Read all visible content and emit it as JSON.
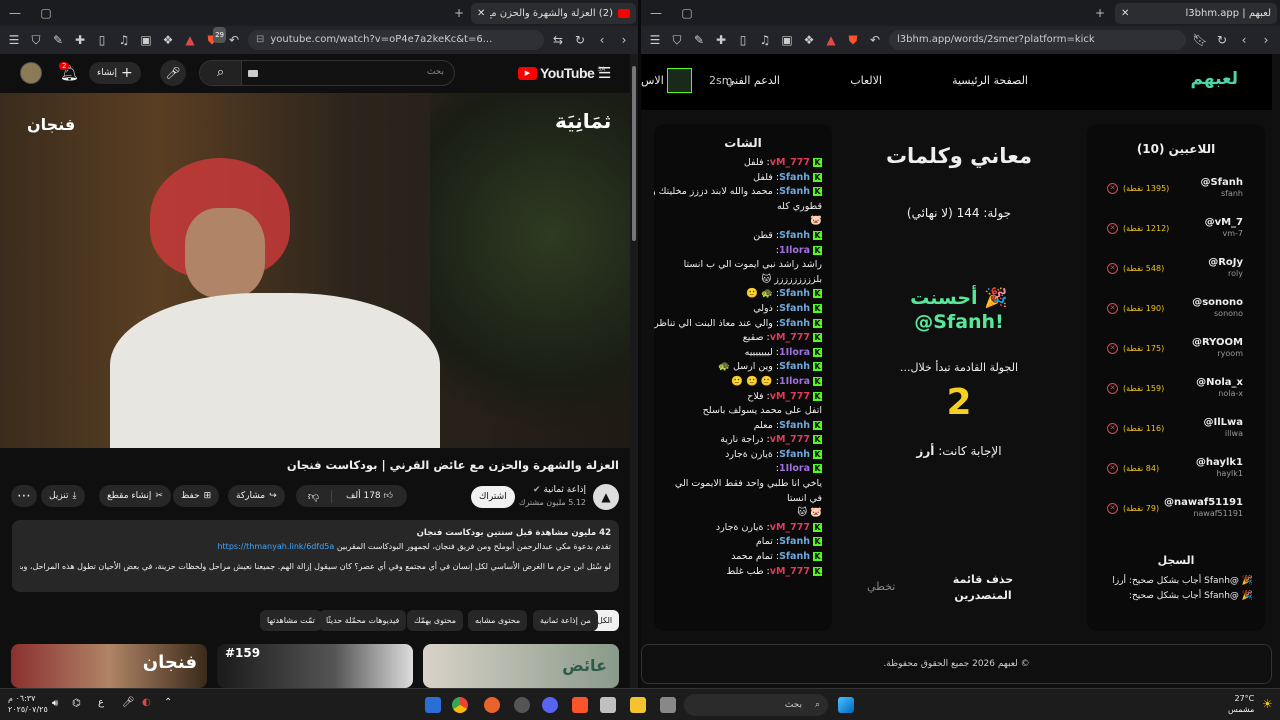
{
  "left_window": {
    "tab_title": "(2) العزلة والشهرة والحزن مع عا",
    "tab_badge": "29",
    "url": "youtube.com/watch?v=oP4e7a2keKc&t=6...",
    "youtube": {
      "logo": "YouTube",
      "country": "SA",
      "search_placeholder": "بحث",
      "create_label": "إنشاء",
      "notif_count": "2",
      "video_overlay_left": "فنجان",
      "video_overlay_right": "ثمَانِيَة",
      "title": "العزلة والشهرة والحزن مع عائض القرني | بودكاست فنجان",
      "channel_name": "إذاعة ثمانية",
      "subscribers": "5.12 مليون مشترك",
      "subscribe_label": "اشتراك",
      "like_count": "178 ألف",
      "actions": [
        "مشاركة",
        "حفظ",
        "إنشاء مقطع",
        "تنزيل"
      ],
      "description_stats": "42 مليون مشاهدة  قبل سنتين  بودكاست فنجان",
      "description_line1": "تقدم بدعوة مكي عبدالرحمن أبوملح ومن فريق فنجان، لجمهور البودكاست المقربين",
      "description_link": "https://thmanyah.link/6dfd5a",
      "description_line2": "لو سُئل ابن حزم ما الغرض الأساسي لكل إنسان في أي مجتمع وفي أي عصر؟ كان سيقول إزالة الهم. جميعنا نعيش مراحل ولحظات حزينة، في بعض الأحيان تطول هذه المراحل، وبعض الناس يكون ...المزيد",
      "chips": [
        "الكل",
        "من إذاعة ثمانية",
        "محتوى مشابه",
        "محتوى يهمّك",
        "فيديوهات محمّلة حديثًا",
        "تمّت مشاهدتها"
      ],
      "thumb_labels": [
        "عائض",
        "#159",
        "فنجان"
      ]
    }
  },
  "right_window": {
    "tab_title": "لعبهم | l3bhm.app",
    "url": "l3bhm.app/words/2smer?platform=kick",
    "nav": {
      "logo": "لعبهم",
      "items": [
        "الصفحة الرئيسية",
        "الالعاب",
        "الدعم الفني"
      ],
      "user_partial": "2sm",
      "user_partial2": "الاس"
    },
    "players_title": "اللاعبين (10)",
    "players": [
      {
        "name": "@Sfanh",
        "handle": "sfanh",
        "points": "(1395 نقطة)"
      },
      {
        "name": "@vM_7",
        "handle": "vm-7",
        "points": "(1212 نقطة)"
      },
      {
        "name": "@RoJy",
        "handle": "roly",
        "points": "(548 نقطة)"
      },
      {
        "name": "@sonono",
        "handle": "sonono",
        "points": "(190 نقطة)"
      },
      {
        "name": "@RYOOM",
        "handle": "ryoom",
        "points": "(175 نقطة)"
      },
      {
        "name": "@Nola_x",
        "handle": "nola-x",
        "points": "(159 نقطة)"
      },
      {
        "name": "@IlLwa",
        "handle": "illwa",
        "points": "(116 نقطة)"
      },
      {
        "name": "@haylk1",
        "handle": "haylk1",
        "points": "(84 نقطة)"
      },
      {
        "name": "@nawaf51191",
        "handle": "nawaf51191",
        "points": "(79 نقطة)"
      }
    ],
    "log_title": "السجل",
    "log": [
      "🎉 @Sfanh أجاب بشكل صحيح: أرزا",
      "🎉 @Sfanh أجاب بشكل صحيح:"
    ],
    "game_title": "معاني وكلمات",
    "round": "جولة: 144 (لا نهائي)",
    "correct_line1": "🎉 أحسنت",
    "correct_line2": "@Sfanh!",
    "next_round": "الجولة القادمة تبدأ خلال...",
    "countdown": "2",
    "answer_label": "الإجابة كانت:",
    "answer": "أرز",
    "delete_top": "حذف قائمة المتصدرين",
    "skip": "تخطي",
    "chat_title": "الشات",
    "chat": [
      {
        "u": "vM_777",
        "c": "#e03b5c",
        "t": "فلفل"
      },
      {
        "u": "Sfanh",
        "c": "#6fa8dc",
        "t": "فلفل"
      },
      {
        "u": "Sfanh",
        "c": "#6fa8dc",
        "t": "محمد والله لابند دززز مخليتك وقت"
      },
      {
        "u": "",
        "c": "",
        "t": "قطوري كله"
      },
      {
        "u": "",
        "c": "",
        "t": "🐷"
      },
      {
        "u": "Sfanh",
        "c": "#6fa8dc",
        "t": "قطن"
      },
      {
        "u": "1Ilora",
        "c": "#a070e0",
        "t": ""
      },
      {
        "u": "",
        "c": "",
        "t": "راشد راشد نبي ايموت الي ب انستا"
      },
      {
        "u": "",
        "c": "",
        "t": "بلززززززززز 🐱"
      },
      {
        "u": "Sfanh",
        "c": "#6fa8dc",
        "t": "🐢 🙂"
      },
      {
        "u": "Sfanh",
        "c": "#6fa8dc",
        "t": "ذولي"
      },
      {
        "u": "Sfanh",
        "c": "#6fa8dc",
        "t": "والي عند معاذ البنت الي تناظر"
      },
      {
        "u": "vM_777",
        "c": "#e03b5c",
        "t": "صقيع"
      },
      {
        "u": "1Ilora",
        "c": "#a070e0",
        "t": "ليييييييه"
      },
      {
        "u": "Sfanh",
        "c": "#6fa8dc",
        "t": "وين ارسل 🐢"
      },
      {
        "u": "1Ilora",
        "c": "#a070e0",
        "t": "🙂 🙂 🙂"
      },
      {
        "u": "vM_777",
        "c": "#e03b5c",
        "t": "فلاح"
      },
      {
        "u": "",
        "c": "",
        "t": "اتفل على محمد يسولف باسلح"
      },
      {
        "u": "Sfanh",
        "c": "#6fa8dc",
        "t": "معلم"
      },
      {
        "u": "vM_777",
        "c": "#e03b5c",
        "t": "دراجة نارية"
      },
      {
        "u": "Sfanh",
        "c": "#6fa8dc",
        "t": "ةيارن ةجارد"
      },
      {
        "u": "1Ilora",
        "c": "#a070e0",
        "t": ""
      },
      {
        "u": "",
        "c": "",
        "t": "ياخي انا طلبي واحد فقط الايموت الي"
      },
      {
        "u": "",
        "c": "",
        "t": "في انستا"
      },
      {
        "u": "",
        "c": "",
        "t": "🐷 🐱"
      },
      {
        "u": "vM_777",
        "c": "#e03b5c",
        "t": "ةيارن ةجارد"
      },
      {
        "u": "Sfanh",
        "c": "#6fa8dc",
        "t": "تمام"
      },
      {
        "u": "Sfanh",
        "c": "#6fa8dc",
        "t": "تمام محمد"
      },
      {
        "u": "vM_777",
        "c": "#e03b5c",
        "t": "طب غلط"
      }
    ],
    "footer": "© لعبهم 2026 جميع الحقوق محفوظة."
  },
  "taskbar": {
    "weather_temp": "27°C",
    "weather_desc": "مشمس",
    "search_placeholder": "بحث",
    "time": "٠٦:٣٧ م",
    "date": "٢٠٢٥/٠٧/٢٥",
    "lang": "ع"
  }
}
